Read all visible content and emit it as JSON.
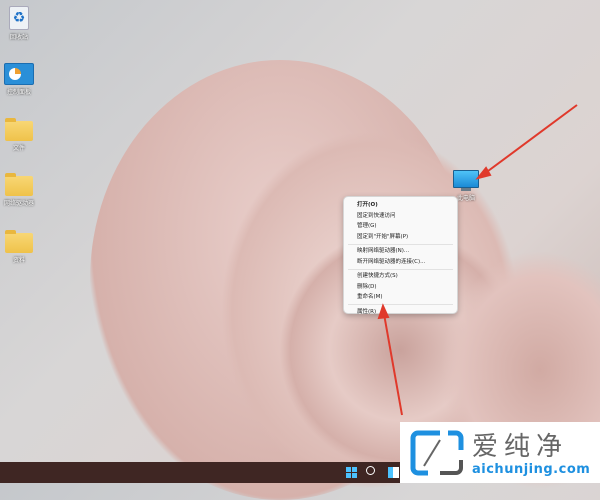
{
  "desktop": {
    "icons": [
      {
        "label": "回收站",
        "type": "recycle-bin"
      },
      {
        "label": "控制面板",
        "type": "control-panel"
      },
      {
        "label": "文件",
        "type": "folder"
      },
      {
        "label": "网络驱动器",
        "type": "folder-shortcut"
      },
      {
        "label": "资料",
        "type": "folder-shortcut"
      }
    ],
    "this_pc_label": "此电脑"
  },
  "context_menu": {
    "groups": [
      [
        "打开(O)",
        "固定到快速访问",
        "管理(G)",
        "固定到\"开始\"屏幕(P)"
      ],
      [
        "映射网络驱动器(N)...",
        "断开网络驱动器的连接(C)..."
      ],
      [
        "创建快捷方式(S)",
        "删除(D)",
        "重命名(M)"
      ],
      [
        "属性(R)"
      ]
    ]
  },
  "watermark": {
    "brand": "爱纯净",
    "url": "aichunjing.com"
  },
  "colors": {
    "arrow": "#e0392b",
    "taskbar": "#3f2623",
    "accent": "#1e90e0"
  }
}
